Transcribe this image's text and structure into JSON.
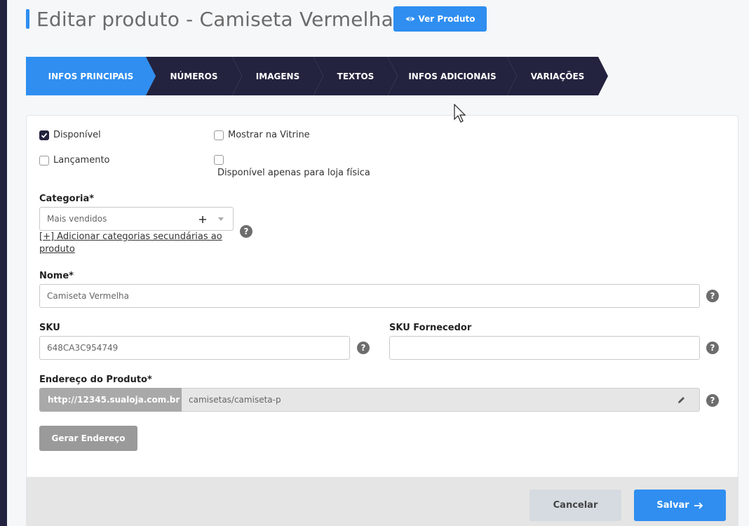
{
  "header": {
    "title": "Editar produto - Camiseta Vermelha",
    "view_button_label": "Ver Produto"
  },
  "tabs": [
    {
      "label": "INFOS PRINCIPAIS",
      "active": true
    },
    {
      "label": "NÚMEROS",
      "active": false
    },
    {
      "label": "IMAGENS",
      "active": false
    },
    {
      "label": "TEXTOS",
      "active": false
    },
    {
      "label": "INFOS ADICIONAIS",
      "active": false
    },
    {
      "label": "VARIAÇÕES",
      "active": false
    }
  ],
  "checkboxes": {
    "disponivel": {
      "label": "Disponível",
      "checked": true
    },
    "vitrine": {
      "label": "Mostrar na Vitrine",
      "checked": false
    },
    "lancamento": {
      "label": "Lançamento",
      "checked": false
    },
    "loja_fisica": {
      "label": "Disponível apenas para loja física",
      "checked": false
    }
  },
  "categoria": {
    "label": "Categoria*",
    "value": "Mais vendidos",
    "add_link": "[+] Adicionar categorias secundárias ao produto"
  },
  "nome": {
    "label": "Nome*",
    "value": "Camiseta Vermelha"
  },
  "sku": {
    "label": "SKU",
    "value": "648CA3C954749"
  },
  "sku_fornecedor": {
    "label": "SKU Fornecedor",
    "value": ""
  },
  "endereco": {
    "label": "Endereço do Produto*",
    "prefix": "http://12345.sualoja.com.br",
    "slug": "camisetas/camiseta-p",
    "generate_button": "Gerar Endereço"
  },
  "help_symbol": "?",
  "footer": {
    "cancel_label": "Cancelar",
    "save_label": "Salvar"
  },
  "colors": {
    "accent": "#2f8ef0",
    "nav_dark": "#23233f",
    "help_gray": "#6d6d6d"
  }
}
